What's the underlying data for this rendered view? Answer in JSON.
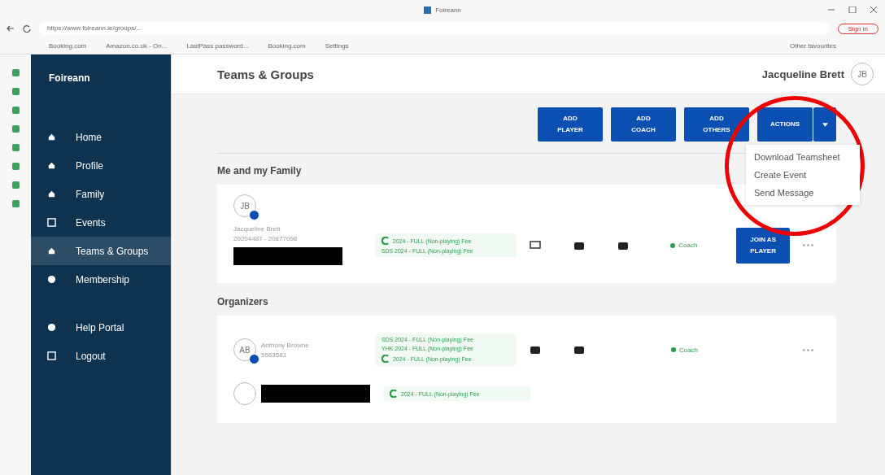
{
  "browser": {
    "tab_title": "Foireann",
    "address": "https://www.foireann.ie/groups/...",
    "sign_in": "Sign in",
    "bookmarks": [
      "Booking.com",
      "Amazon.co.uk - On...",
      "LastPass password...",
      "Booking.com",
      "Settings"
    ],
    "other_favourites": "Other favourites"
  },
  "sidebar": {
    "brand": "Foireann",
    "items": [
      {
        "label": "Home",
        "selected": false
      },
      {
        "label": "Profile",
        "selected": false
      },
      {
        "label": "Family",
        "selected": false
      },
      {
        "label": "Events",
        "selected": false
      },
      {
        "label": "Teams & Groups",
        "selected": true
      },
      {
        "label": "Membership",
        "selected": false
      }
    ],
    "bottom_items": [
      {
        "label": "Help Portal"
      },
      {
        "label": "Logout"
      }
    ]
  },
  "header": {
    "title": "Teams & Groups",
    "user_name": "Jacqueline Brett",
    "user_initials": "JB"
  },
  "toolbar": {
    "buttons": [
      [
        "ADD",
        "PLAYER"
      ],
      [
        "ADD",
        "COACH"
      ],
      [
        "ADD",
        "OTHERS"
      ]
    ],
    "actions": "ACTIONS",
    "menu": [
      "Download Teamsheet",
      "Create Event",
      "Send Message"
    ]
  },
  "sections": [
    {
      "title": "Me and my Family",
      "top_avatar": "JB",
      "members": [
        {
          "name": "Jacqueline Brett",
          "id": "20204487 - 20877098",
          "fees": [
            {
              "text": "2024 - FULL (Non-playing) Fee",
              "logo": true
            },
            {
              "text": "SDS 2024 - FULL (Non-playing) Fee",
              "logo": false
            }
          ],
          "role": "Coach",
          "join": "JOIN AS PLAYER",
          "redacted": true
        }
      ]
    },
    {
      "title": "Organizers",
      "members": [
        {
          "initials": "AB",
          "name": "Anthony Browne",
          "id": "5563581",
          "fees": [
            {
              "text": "SDS 2024 - FULL (Non-playing) Fee",
              "logo": false
            },
            {
              "text": "YHK 2024 - FULL (Non-playing) Fee",
              "logo": false
            },
            {
              "text": "2024 - FULL (Non-playing) Fee",
              "logo": true
            }
          ],
          "role": "Coach",
          "redacted": false
        },
        {
          "fees": [
            {
              "text": "2024 - FULL (Non-playing) Fee",
              "logo": true
            }
          ],
          "redacted": true
        }
      ]
    }
  ]
}
